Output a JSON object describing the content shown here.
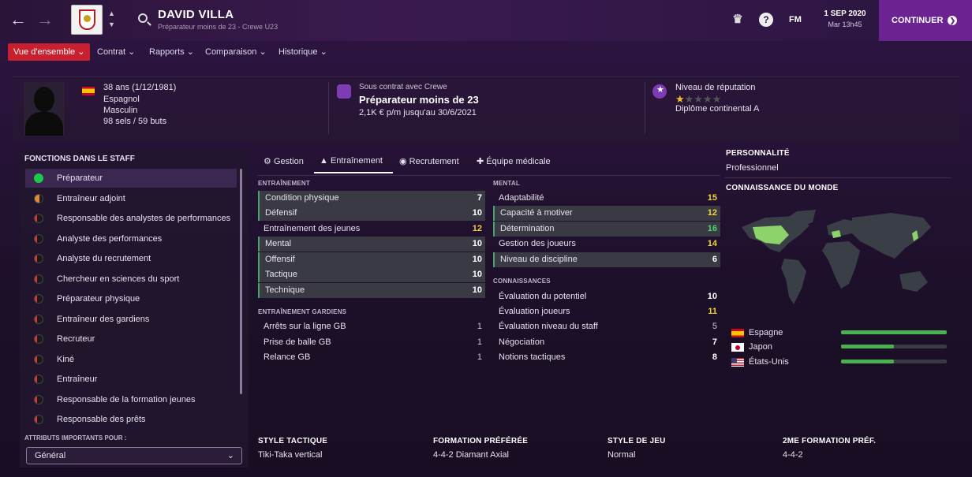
{
  "header": {
    "name": "DAVID VILLA",
    "subtitle": "Préparateur moins de 23 - Crewe U23",
    "date": "1 SEP 2020",
    "time": "Mar 13h45",
    "fm_label": "FM",
    "continue_label": "CONTINUER"
  },
  "menu": [
    {
      "label": "Vue d'ensemble ⌄"
    },
    {
      "label": "Contrat ⌄"
    },
    {
      "label": "Rapports ⌄"
    },
    {
      "label": "Comparaison ⌄"
    },
    {
      "label": "Historique ⌄"
    }
  ],
  "profile": {
    "age": "38 ans (1/12/1981)",
    "nationality": "Espagnol",
    "gender": "Masculin",
    "caps": "98 sels / 59 buts"
  },
  "contract": {
    "status": "Sous contrat avec Crewe",
    "role": "Préparateur moins de 23",
    "wage": "2,1K € p/m jusqu'au 30/6/2021"
  },
  "reputation": {
    "label": "Niveau de réputation",
    "stars": 0.5,
    "max_stars": 5,
    "diploma": "Diplôme continental A"
  },
  "sidebar": {
    "title": "FONCTIONS DANS LE STAFF",
    "roles": [
      "Préparateur",
      "Entraîneur adjoint",
      "Responsable des analystes de performances",
      "Analyste des performances",
      "Analyste du recrutement",
      "Chercheur en sciences du sport",
      "Préparateur physique",
      "Entraîneur des gardiens",
      "Recruteur",
      "Kiné",
      "Entraîneur",
      "Responsable de la formation jeunes",
      "Responsable des prêts"
    ],
    "attr_label": "ATTRIBUTS IMPORTANTS POUR :",
    "attr_value": "Général"
  },
  "tabs": [
    "Gestion",
    "Entraînement",
    "Recrutement",
    "Équipe médicale"
  ],
  "training": {
    "title": "ENTRAÎNEMENT",
    "rows": [
      {
        "label": "Condition physique",
        "value": "7"
      },
      {
        "label": "Défensif",
        "value": "10"
      },
      {
        "label": "Entraînement des jeunes",
        "value": "12"
      },
      {
        "label": "Mental",
        "value": "10"
      },
      {
        "label": "Offensif",
        "value": "10"
      },
      {
        "label": "Tactique",
        "value": "10"
      },
      {
        "label": "Technique",
        "value": "10"
      }
    ]
  },
  "gk": {
    "title": "ENTRAÎNEMENT GARDIENS",
    "rows": [
      {
        "label": "Arrêts sur la ligne GB",
        "value": "1"
      },
      {
        "label": "Prise de balle GB",
        "value": "1"
      },
      {
        "label": "Relance GB",
        "value": "1"
      }
    ]
  },
  "mental": {
    "title": "MENTAL",
    "rows": [
      {
        "label": "Adaptabilité",
        "value": "15"
      },
      {
        "label": "Capacité à motiver",
        "value": "12"
      },
      {
        "label": "Détermination",
        "value": "16"
      },
      {
        "label": "Gestion des joueurs",
        "value": "14"
      },
      {
        "label": "Niveau de discipline",
        "value": "6"
      }
    ]
  },
  "knowledge": {
    "title": "CONNAISSANCES",
    "rows": [
      {
        "label": "Évaluation du potentiel",
        "value": "10"
      },
      {
        "label": "Évaluation joueurs",
        "value": "11"
      },
      {
        "label": "Évaluation niveau du staff",
        "value": "5"
      },
      {
        "label": "Négociation",
        "value": "7"
      },
      {
        "label": "Notions tactiques",
        "value": "8"
      }
    ]
  },
  "personality": {
    "title": "PERSONNALITÉ",
    "value": "Professionnel"
  },
  "world": {
    "title": "CONNAISSANCE DU MONDE",
    "countries": [
      {
        "name": "Espagne",
        "level": 1.0
      },
      {
        "name": "Japon",
        "level": 0.5
      },
      {
        "name": "États-Unis",
        "level": 0.5
      }
    ]
  },
  "bottom": [
    {
      "label": "STYLE TACTIQUE",
      "value": "Tiki-Taka vertical"
    },
    {
      "label": "FORMATION PRÉFÉRÉE",
      "value": "4-4-2 Diamant Axial"
    },
    {
      "label": "STYLE DE JEU",
      "value": "Normal"
    },
    {
      "label": "2ME FORMATION PRÉF.",
      "value": "4-4-2"
    }
  ],
  "colors": {
    "accent": "#c8202f",
    "continue": "#6a2390",
    "good": "#4caf50",
    "yellow": "#f2d23a"
  }
}
